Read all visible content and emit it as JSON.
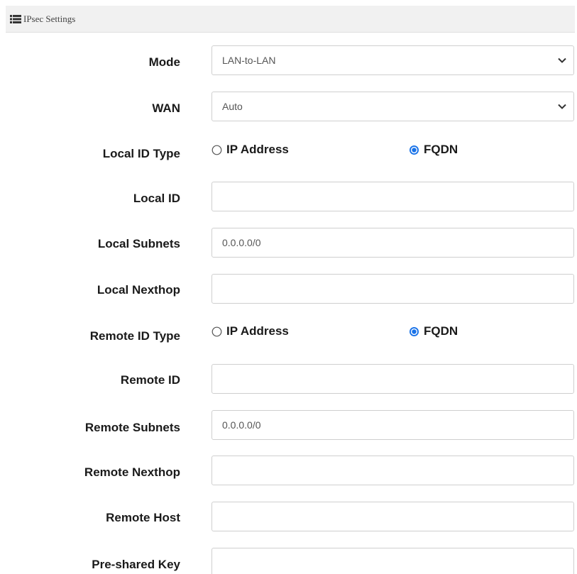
{
  "header": {
    "title": "IPsec Settings",
    "icon": "list-icon"
  },
  "fields": {
    "mode": {
      "label": "Mode",
      "value": "LAN-to-LAN"
    },
    "wan": {
      "label": "WAN",
      "value": "Auto"
    },
    "local_id_type": {
      "label": "Local ID Type",
      "options": [
        "IP Address",
        "FQDN"
      ],
      "selected": "FQDN"
    },
    "local_id": {
      "label": "Local ID",
      "value": ""
    },
    "local_subnets": {
      "label": "Local Subnets",
      "value": "0.0.0.0/0"
    },
    "local_nexthop": {
      "label": "Local Nexthop",
      "value": ""
    },
    "remote_id_type": {
      "label": "Remote ID Type",
      "options": [
        "IP Address",
        "FQDN"
      ],
      "selected": "FQDN"
    },
    "remote_id": {
      "label": "Remote ID",
      "value": ""
    },
    "remote_subnets": {
      "label": "Remote Subnets",
      "value": "0.0.0.0/0"
    },
    "remote_nexthop": {
      "label": "Remote Nexthop",
      "value": ""
    },
    "remote_host": {
      "label": "Remote Host",
      "value": ""
    },
    "pre_shared_key": {
      "label": "Pre-shared Key",
      "value": ""
    }
  },
  "colors": {
    "accent": "#1a73e8",
    "header_bg": "#f1f1f1",
    "border": "#cfcfcf"
  }
}
